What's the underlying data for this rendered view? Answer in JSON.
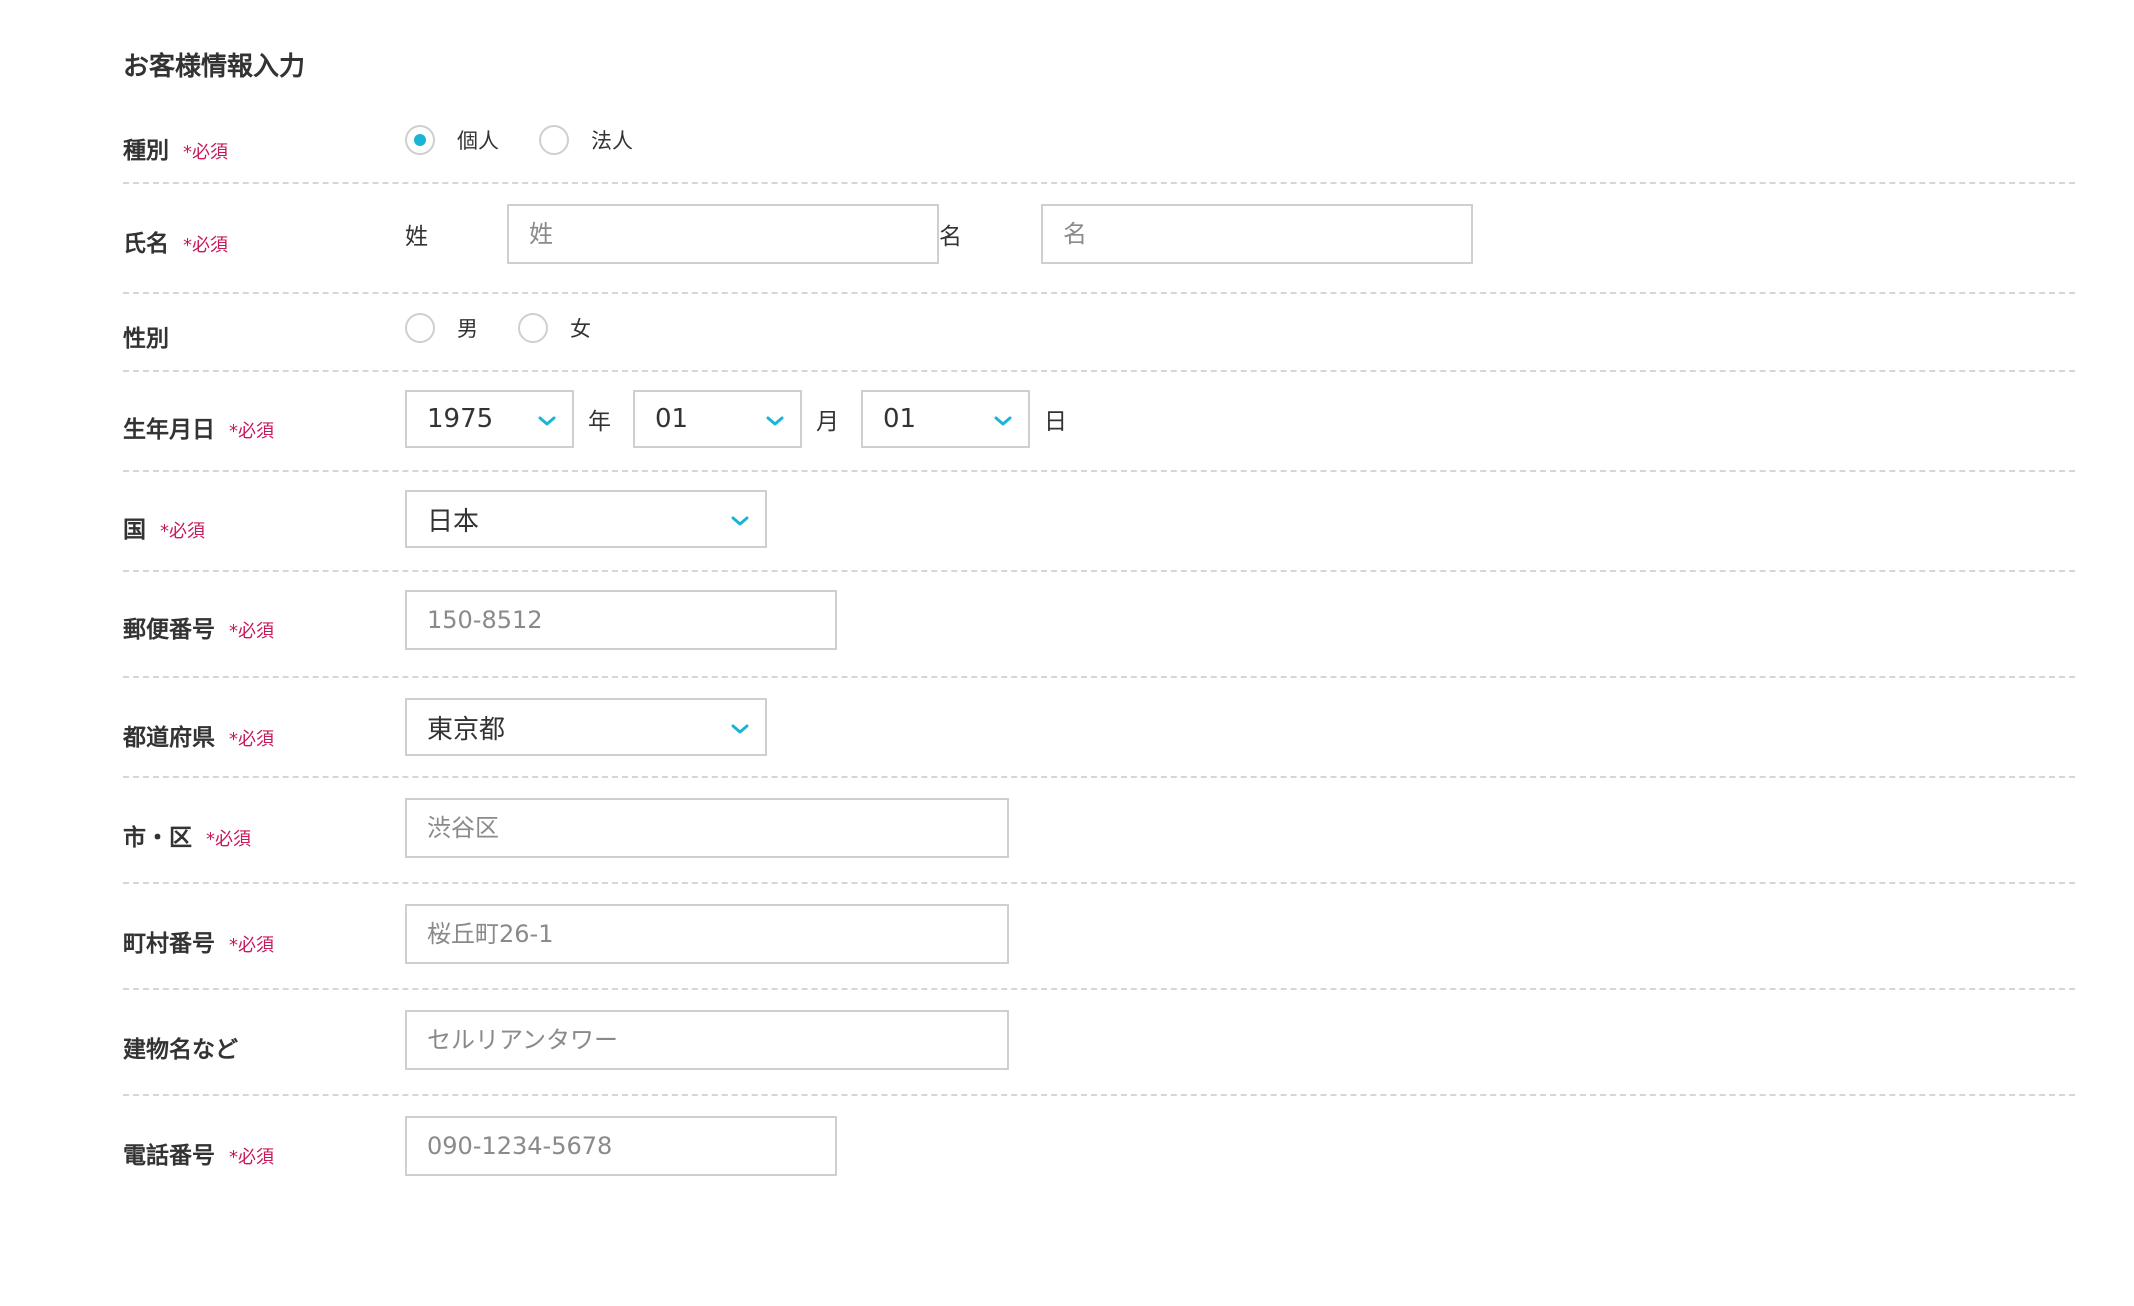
{
  "form": {
    "title": "お客様情報入力",
    "required_mark": "*必須",
    "type": {
      "label": "種別",
      "options": [
        {
          "label": "個人",
          "checked": true
        },
        {
          "label": "法人",
          "checked": false
        }
      ]
    },
    "name": {
      "label": "氏名",
      "last_label": "姓",
      "last_placeholder": "姓",
      "first_label": "名",
      "first_placeholder": "名"
    },
    "gender": {
      "label": "性別",
      "options": [
        {
          "label": "男",
          "checked": false
        },
        {
          "label": "女",
          "checked": false
        }
      ]
    },
    "birthdate": {
      "label": "生年月日",
      "year": "1975",
      "year_unit": "年",
      "month": "01",
      "month_unit": "月",
      "day": "01",
      "day_unit": "日"
    },
    "country": {
      "label": "国",
      "value": "日本"
    },
    "postal": {
      "label": "郵便番号",
      "placeholder": "150-8512"
    },
    "prefecture": {
      "label": "都道府県",
      "value": "東京都"
    },
    "city": {
      "label": "市・区",
      "placeholder": "渋谷区"
    },
    "street": {
      "label": "町村番号",
      "placeholder": "桜丘町26-1"
    },
    "building": {
      "label": "建物名など",
      "placeholder": "セルリアンタワー"
    },
    "phone": {
      "label": "電話番号",
      "placeholder": "090-1234-5678"
    }
  },
  "colors": {
    "accent": "#1ab5d6",
    "required": "#c8185c",
    "border": "#cfcfcf",
    "divider": "#d6d6d6"
  },
  "icons": {
    "select_arrow": "chevron-down-icon",
    "radio": "radio-icon"
  }
}
